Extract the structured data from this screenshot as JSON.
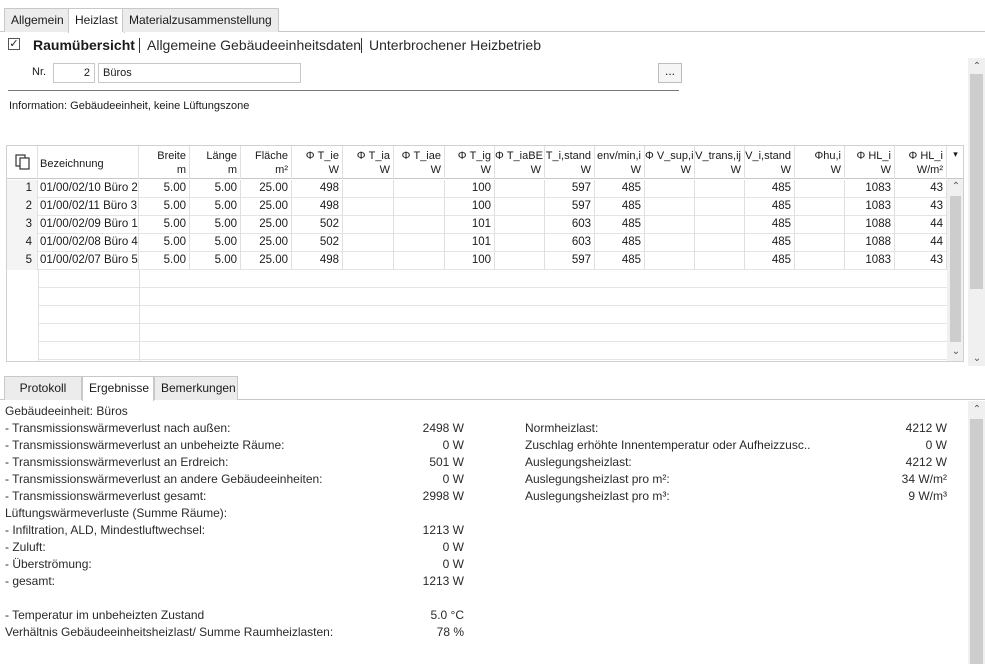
{
  "tabs": [
    "Allgemein",
    "Heizlast",
    "Materialzusammenstellung"
  ],
  "active_tab": "Heizlast",
  "header": {
    "checkbox_checked": "✓",
    "items": [
      "Raumübersicht",
      "Allgemeine Gebäudeeinheitsdaten",
      "Unterbrochener Heizbetrieb"
    ]
  },
  "form": {
    "nr_label": "Nr.",
    "nr_value": "2",
    "name_value": "Büros",
    "more_button": "..."
  },
  "info_text": "Information: Gebäudeeinheit, keine Lüftungszone",
  "table": {
    "columns": [
      {
        "l1": "Bezeichnung",
        "l2": ""
      },
      {
        "l1": "Breite",
        "l2": "m"
      },
      {
        "l1": "Länge",
        "l2": "m"
      },
      {
        "l1": "Fläche",
        "l2": "m²"
      },
      {
        "l1": "Φ T_ie",
        "l2": "W"
      },
      {
        "l1": "Φ T_ia",
        "l2": "W"
      },
      {
        "l1": "Φ T_iae",
        "l2": "W"
      },
      {
        "l1": "Φ T_ig",
        "l2": "W"
      },
      {
        "l1": "Φ T_iaBE",
        "l2": "W"
      },
      {
        "l1": "T_i,stand",
        "l2": "W"
      },
      {
        "l1": "env/min,i",
        "l2": "W"
      },
      {
        "l1": "Φ V_sup,i",
        "l2": "W"
      },
      {
        "l1": "V_trans,ij",
        "l2": "W"
      },
      {
        "l1": "V_i,stand",
        "l2": "W"
      },
      {
        "l1": "Φhu,i",
        "l2": "W"
      },
      {
        "l1": "Φ HL_i",
        "l2": "W"
      },
      {
        "l1": "Φ HL_i",
        "l2": "W/m²"
      }
    ],
    "rows": [
      {
        "nr": "1",
        "cells": [
          "01/00/02/10 Büro 2",
          "5.00",
          "5.00",
          "25.00",
          "498",
          "",
          "",
          "100",
          "",
          "597",
          "485",
          "",
          "",
          "485",
          "",
          "1083",
          "43"
        ]
      },
      {
        "nr": "2",
        "cells": [
          "01/00/02/11 Büro 3",
          "5.00",
          "5.00",
          "25.00",
          "498",
          "",
          "",
          "100",
          "",
          "597",
          "485",
          "",
          "",
          "485",
          "",
          "1083",
          "43"
        ]
      },
      {
        "nr": "3",
        "cells": [
          "01/00/02/09 Büro 1",
          "5.00",
          "5.00",
          "25.00",
          "502",
          "",
          "",
          "101",
          "",
          "603",
          "485",
          "",
          "",
          "485",
          "",
          "1088",
          "44"
        ]
      },
      {
        "nr": "4",
        "cells": [
          "01/00/02/08 Büro 4",
          "5.00",
          "5.00",
          "25.00",
          "502",
          "",
          "",
          "101",
          "",
          "603",
          "485",
          "",
          "",
          "485",
          "",
          "1088",
          "44"
        ]
      },
      {
        "nr": "5",
        "cells": [
          "01/00/02/07 Büro 5",
          "5.00",
          "5.00",
          "25.00",
          "498",
          "",
          "",
          "100",
          "",
          "597",
          "485",
          "",
          "",
          "485",
          "",
          "1083",
          "43"
        ]
      }
    ]
  },
  "bottom_tabs": [
    "Protokoll",
    "Ergebnisse",
    "Bemerkungen"
  ],
  "bottom_active_tab": "Ergebnisse",
  "results": {
    "left": [
      {
        "label": "Gebäudeeinheit: Büros",
        "value": ""
      },
      {
        "label": "- Transmissionswärmeverlust nach außen:",
        "value": "2498 W"
      },
      {
        "label": "- Transmissionswärmeverlust an unbeheizte Räume:",
        "value": "0 W"
      },
      {
        "label": "- Transmissionswärmeverlust an Erdreich:",
        "value": "501 W"
      },
      {
        "label": "- Transmissionswärmeverlust an andere Gebäudeeinheiten:",
        "value": "0 W"
      },
      {
        "label": "- Transmissionswärmeverlust gesamt:",
        "value": "2998 W"
      },
      {
        "label": "Lüftungswärmeverluste (Summe Räume):",
        "value": ""
      },
      {
        "label": "- Infiltration, ALD, Mindestluftwechsel:",
        "value": "1213 W"
      },
      {
        "label": "- Zuluft:",
        "value": "0 W"
      },
      {
        "label": "- Überströmung:",
        "value": "0 W"
      },
      {
        "label": "- gesamt:",
        "value": "1213 W"
      },
      {
        "label": "",
        "value": ""
      },
      {
        "label": "- Temperatur im unbeheizten Zustand",
        "value": "5.0 °C"
      },
      {
        "label": "Verhältnis Gebäudeeinheitsheizlast/ Summe Raumheizlasten:",
        "value": "78 %"
      }
    ],
    "right": [
      {
        "label": "Normheizlast:",
        "value": "4212 W"
      },
      {
        "label": "Zuschlag erhöhte Innentemperatur oder Aufheizzusc..",
        "value": "0 W"
      },
      {
        "label": "Auslegungsheizlast:",
        "value": "4212 W"
      },
      {
        "label": "Auslegungsheizlast pro m²:",
        "value": "34 W/m²"
      },
      {
        "label": "Auslegungsheizlast pro m³:",
        "value": "9 W/m³"
      }
    ]
  }
}
